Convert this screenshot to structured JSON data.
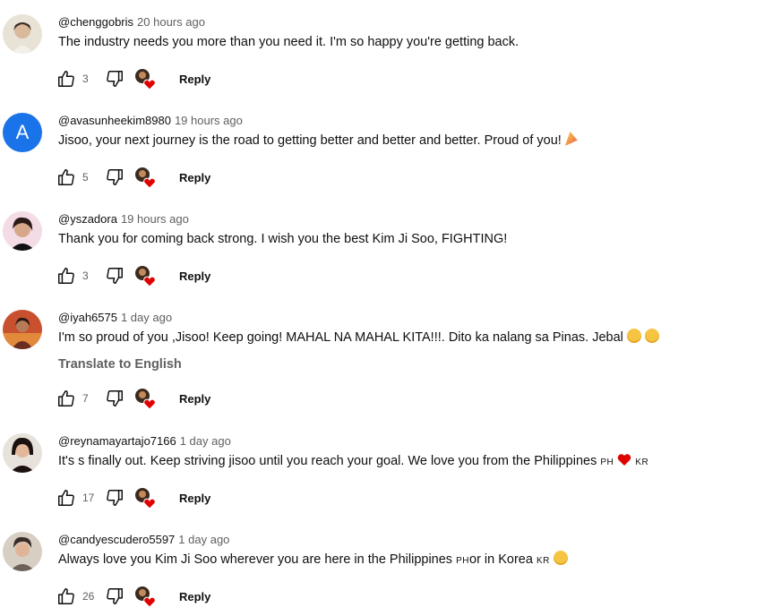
{
  "comments": [
    {
      "handle": "@chenggobris",
      "time": "20 hours ago",
      "text": "The industry needs you more than you need it. I'm so happy you're getting back.",
      "likes": "3",
      "reply": "Reply"
    },
    {
      "handle": "@avasunheekim8980",
      "time": "19 hours ago",
      "text": "Jisoo, your next journey is the road to getting better and better and better. Proud of you! ",
      "avatar_letter": "A",
      "likes": "5",
      "reply": "Reply"
    },
    {
      "handle": "@yszadora",
      "time": "19 hours ago",
      "text": "Thank you for coming back strong. I wish you the best Kim Ji Soo, FIGHTING!",
      "likes": "3",
      "reply": "Reply"
    },
    {
      "handle": "@iyah6575",
      "time": "1 day ago",
      "text": "I'm so proud of you ,Jisoo! Keep going! MAHAL NA MAHAL KITA!!!. Dito ka nalang sa Pinas. Jebal ",
      "translate": "Translate to English",
      "likes": "7",
      "reply": "Reply"
    },
    {
      "handle": "@reynamayartajo7166",
      "time": "1 day ago",
      "text_a": "It's s finally out. Keep striving jisoo until you reach  your goal.  We love you from the Philippines ",
      "flag_a": "PH",
      "flag_b": "KR",
      "likes": "17",
      "reply": "Reply"
    },
    {
      "handle": "@candyescudero5597",
      "time": "1 day ago",
      "text_a": "Always love you Kim Ji Soo  wherever you are here in the Philippines ",
      "flag_a": "PH",
      "text_b": "or in Korea ",
      "flag_b": "KR",
      "likes": "26",
      "reply": "Reply"
    }
  ],
  "colors": {
    "text": "#0f0f0f",
    "secondary": "#606060",
    "avatar_blue": "#1a73e8",
    "heart": "#e00000"
  },
  "icons": {
    "like": "thumbs-up-icon",
    "dislike": "thumbs-down-icon",
    "creator_heart": "creator-heart-icon",
    "party": "party-popper-emoji",
    "pleading": "pleading-face-emoji",
    "red_heart": "red-heart-emoji",
    "smile": "smiling-face-emoji"
  }
}
